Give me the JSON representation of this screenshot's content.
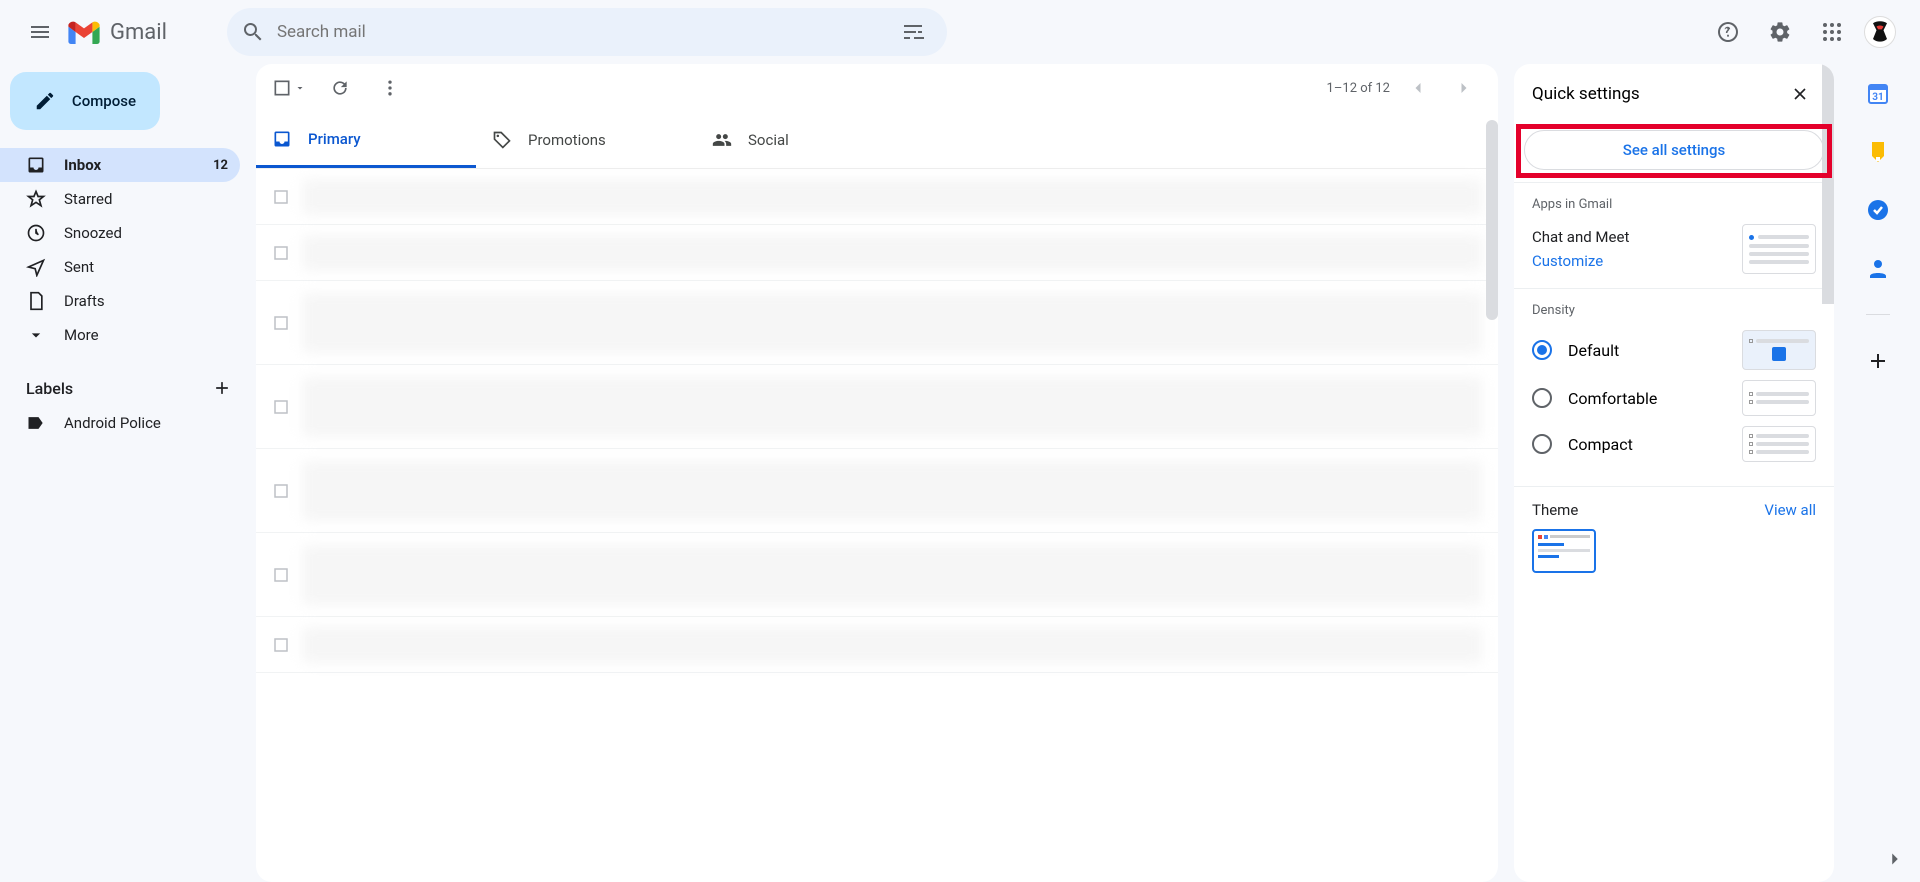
{
  "header": {
    "app_name": "Gmail",
    "search_placeholder": "Search mail"
  },
  "sidebar": {
    "compose_label": "Compose",
    "items": [
      {
        "label": "Inbox",
        "count": "12",
        "active": true
      },
      {
        "label": "Starred"
      },
      {
        "label": "Snoozed"
      },
      {
        "label": "Sent"
      },
      {
        "label": "Drafts"
      },
      {
        "label": "More"
      }
    ],
    "labels_header": "Labels",
    "labels": [
      {
        "label": "Android Police"
      }
    ]
  },
  "toolbar": {
    "pager_text": "1–12 of 12"
  },
  "tabs": [
    {
      "label": "Primary",
      "active": true
    },
    {
      "label": "Promotions"
    },
    {
      "label": "Social"
    }
  ],
  "quick_settings": {
    "title": "Quick settings",
    "see_all": "See all settings",
    "apps_section": "Apps in Gmail",
    "chat_meet": "Chat and Meet",
    "customize": "Customize",
    "density_section": "Density",
    "density_options": [
      "Default",
      "Comfortable",
      "Compact"
    ],
    "density_selected": 0,
    "theme_section": "Theme",
    "view_all": "View all"
  },
  "highlight": {
    "target_name": "see-all-settings-button",
    "color": "#e4002b"
  }
}
